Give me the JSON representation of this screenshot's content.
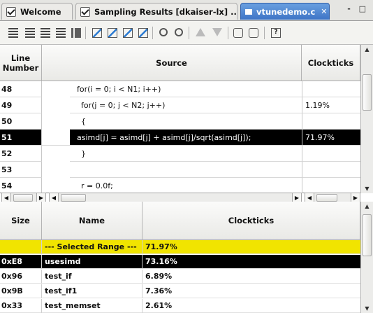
{
  "tabs": [
    {
      "label": "Welcome"
    },
    {
      "label": "Sampling Results [dkaiser-lx] ..."
    },
    {
      "label": "vtunedemo.c"
    }
  ],
  "window_controls": "- □",
  "source_view": {
    "headers": {
      "line": "Line Number",
      "source": "Source",
      "clockticks": "Clockticks"
    },
    "rows": [
      {
        "line": "48",
        "code": "for(i = 0; i < N1; i++)",
        "clockticks": ""
      },
      {
        "line": "49",
        "code": "for(j = 0; j < N2; j++)",
        "clockticks": "1.19%"
      },
      {
        "line": "50",
        "code": "{",
        "clockticks": ""
      },
      {
        "line": "51",
        "code": "asimd[j] = asimd[j] + asimd[j]/sqrt(asimd[j]);",
        "clockticks": "71.97%"
      },
      {
        "line": "52",
        "code": "}",
        "clockticks": ""
      },
      {
        "line": "53",
        "code": "",
        "clockticks": ""
      },
      {
        "line": "54",
        "code": "r = 0.0f;",
        "clockticks": ""
      }
    ]
  },
  "function_view": {
    "headers": {
      "size": "Size",
      "name": "Name",
      "clockticks": "Clockticks"
    },
    "rows": [
      {
        "size": "",
        "name": "--- Selected Range ---",
        "clockticks": "71.97%"
      },
      {
        "size": "0xE8",
        "name": "usesimd",
        "clockticks": "73.16%"
      },
      {
        "size": "0x96",
        "name": "test_if",
        "clockticks": "6.89%"
      },
      {
        "size": "0x9B",
        "name": "test_if1",
        "clockticks": "7.36%"
      },
      {
        "size": "0x33",
        "name": "test_memset",
        "clockticks": "2.61%"
      }
    ]
  },
  "colors": {
    "selection": "#000000",
    "selected_range": "#f1e400",
    "active_tab": "#3d74c6"
  }
}
